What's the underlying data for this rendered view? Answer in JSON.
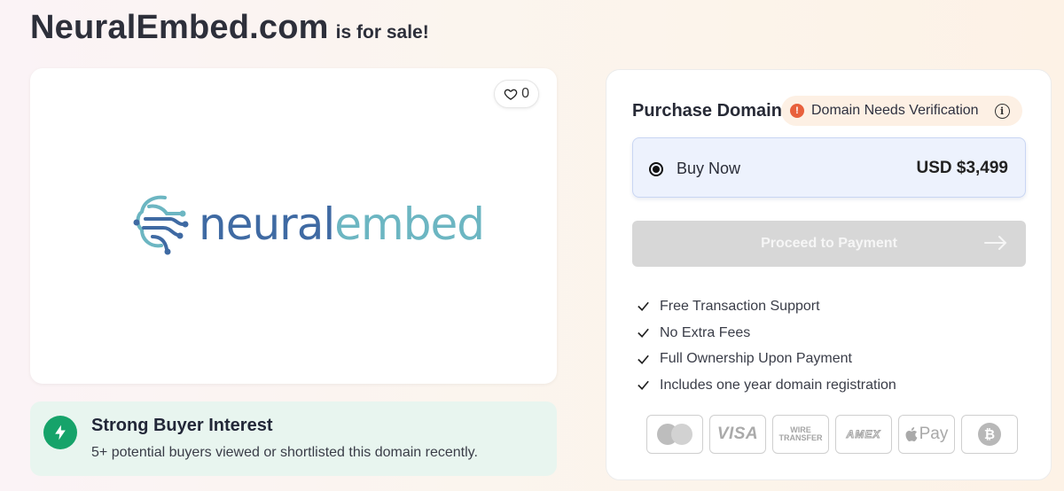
{
  "header": {
    "domain": "NeuralEmbed.com",
    "suffix": "is for sale!"
  },
  "logo_card": {
    "like_count": "0",
    "logo_text_part1": "neural",
    "logo_text_part2": "embed",
    "logo_colors": {
      "primary": "#3f6aa3",
      "secondary": "#6cb6c2"
    }
  },
  "interest": {
    "heading": "Strong Buyer Interest",
    "description": "5+ potential buyers viewed or shortlisted this domain recently.",
    "accent": "#16a36a"
  },
  "purchase": {
    "title": "Purchase Domain",
    "verification_badge": "Domain Needs Verification",
    "verification_icon_glyph": "!",
    "info_icon_glyph": "i",
    "option": {
      "label": "Buy Now",
      "price": "USD $3,499",
      "selected": true
    },
    "proceed_label": "Proceed to Payment",
    "features": [
      "Free Transaction Support",
      "No Extra Fees",
      "Full Ownership Upon Payment",
      "Includes one year domain registration"
    ],
    "payment_methods": {
      "mastercard": "mastercard-icon",
      "visa": "VISA",
      "wire_line1": "WIRE",
      "wire_line2": "TRANSFER",
      "amex": "AMEX",
      "apple_pay": "Pay",
      "bitcoin": "₿"
    }
  }
}
